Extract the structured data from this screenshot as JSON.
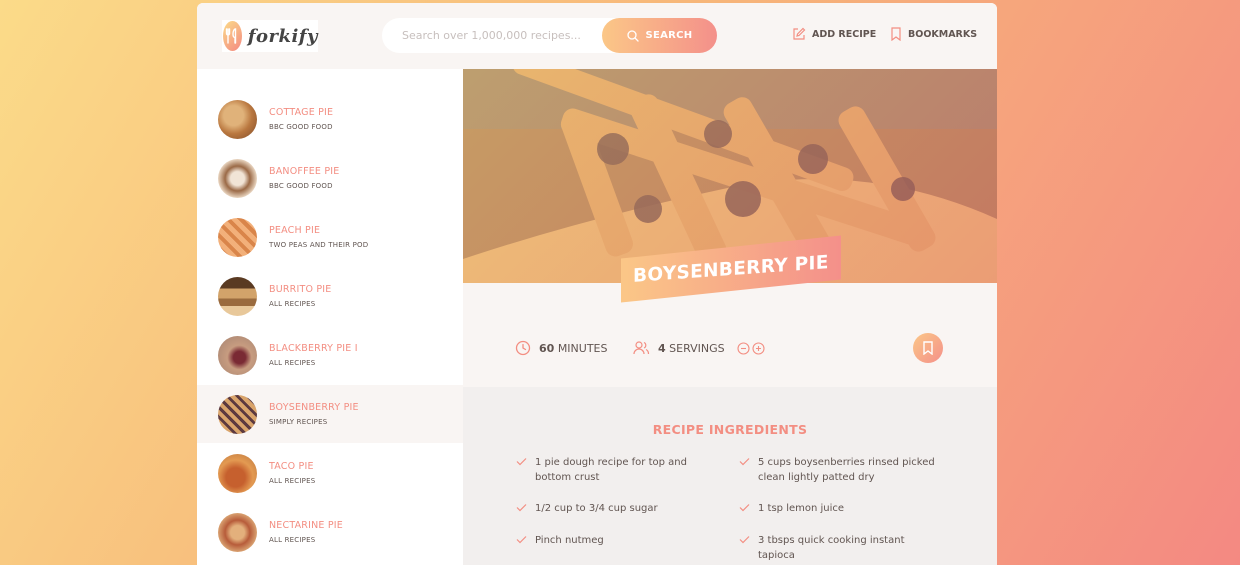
{
  "header": {
    "logo_text": "forkify",
    "search_placeholder": "Search over 1,000,000 recipes...",
    "search_label": "SEARCH",
    "add_recipe_label": "ADD RECIPE",
    "bookmarks_label": "BOOKMARKS"
  },
  "results": [
    {
      "title": "COTTAGE PIE",
      "publisher": "BBC GOOD FOOD"
    },
    {
      "title": "BANOFFEE PIE",
      "publisher": "BBC GOOD FOOD"
    },
    {
      "title": "PEACH PIE",
      "publisher": "TWO PEAS AND THEIR POD"
    },
    {
      "title": "BURRITO PIE",
      "publisher": "ALL RECIPES"
    },
    {
      "title": "BLACKBERRY PIE I",
      "publisher": "ALL RECIPES"
    },
    {
      "title": "BOYSENBERRY PIE",
      "publisher": "SIMPLY RECIPES"
    },
    {
      "title": "TACO PIE",
      "publisher": "ALL RECIPES"
    },
    {
      "title": "NECTARINE PIE",
      "publisher": "ALL RECIPES"
    }
  ],
  "recipe": {
    "title": "BOYSENBERRY PIE",
    "minutes": "60",
    "minutes_label": "MINUTES",
    "servings": "4",
    "servings_label": "SERVINGS",
    "ingredients_heading": "RECIPE INGREDIENTS",
    "ingredients": [
      "1 pie dough recipe for top and bottom crust",
      "5 cups boysenberries rinsed picked clean lightly patted dry",
      "1/2 cup to 3/4 cup sugar",
      "1 tsp lemon juice",
      "Pinch nutmeg",
      "3 tbsps quick cooking instant tapioca"
    ]
  },
  "colors": {
    "accent": "#f38e82",
    "gradient_start": "#fbdb89",
    "gradient_end": "#f48982",
    "text": "#615551"
  },
  "icons": [
    "fork-knife-icon",
    "search-icon",
    "edit-icon",
    "bookmark-icon",
    "clock-icon",
    "users-icon",
    "minus-circle-icon",
    "plus-circle-icon",
    "check-icon"
  ]
}
